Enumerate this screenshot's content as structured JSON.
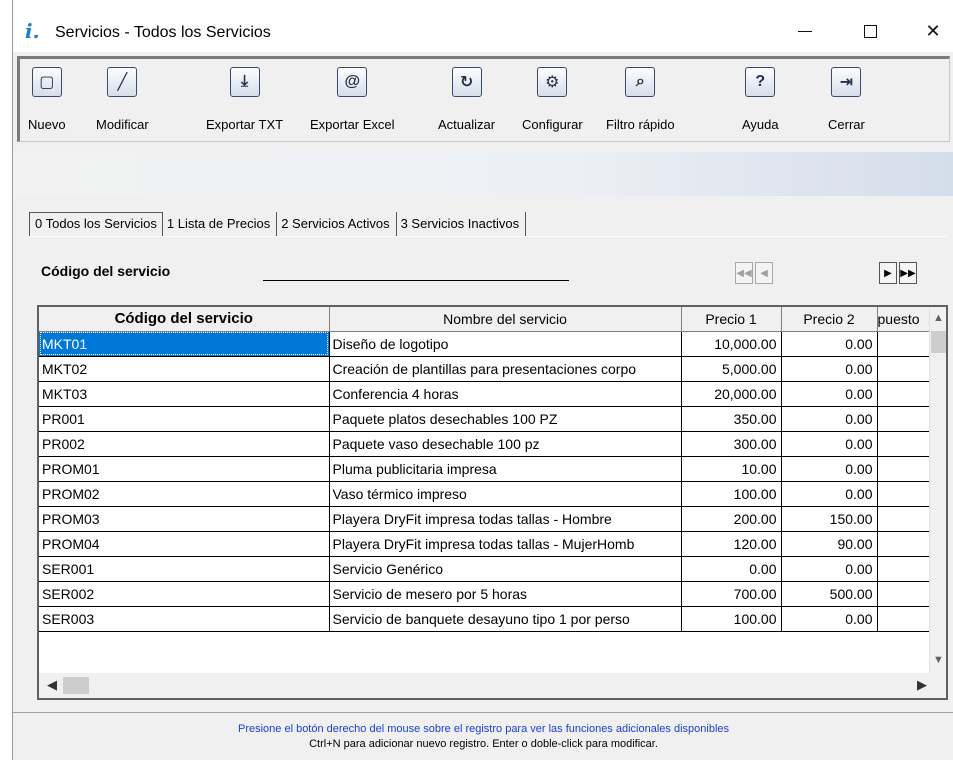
{
  "window": {
    "title": "Servicios - Todos los Servicios",
    "minimize": "—",
    "maximize": "☐",
    "close": "✕"
  },
  "toolbar": {
    "buttons": [
      {
        "label": "Nuevo",
        "icon": "new-document-icon"
      },
      {
        "label": "Modificar",
        "icon": "pencil-icon"
      },
      {
        "label": "Exportar TXT",
        "icon": "export-txt-icon"
      },
      {
        "label": "Exportar Excel",
        "icon": "export-excel-icon"
      },
      {
        "label": "Actualizar",
        "icon": "refresh-icon"
      },
      {
        "label": "Configurar",
        "icon": "gear-icon"
      },
      {
        "label": "Filtro rápido",
        "icon": "search-filter-icon"
      },
      {
        "label": "Ayuda",
        "icon": "help-icon"
      },
      {
        "label": "Cerrar",
        "icon": "exit-icon"
      }
    ]
  },
  "tabs": [
    {
      "label": "0 Todos los Servicios",
      "active": true
    },
    {
      "label": "1 Lista de Precios",
      "active": false
    },
    {
      "label": "2 Servicios Activos",
      "active": false
    },
    {
      "label": "3 Servicios Inactivos",
      "active": false
    }
  ],
  "search": {
    "label": "Código del servicio",
    "value": ""
  },
  "nav": {
    "first": "⏮",
    "prev": "◀",
    "next": "▶",
    "last": "⏭"
  },
  "grid": {
    "columns": [
      "Código del servicio",
      "Nombre del servicio",
      "Precio 1",
      "Precio 2",
      "puesto"
    ],
    "rows": [
      {
        "code": "MKT01",
        "name": "Diseño de logotipo",
        "p1": "10,000.00",
        "p2": "0.00",
        "selected": true
      },
      {
        "code": "MKT02",
        "name": "Creación de plantillas para presentaciones corpo",
        "p1": "5,000.00",
        "p2": "0.00"
      },
      {
        "code": "MKT03",
        "name": "Conferencia 4 horas",
        "p1": "20,000.00",
        "p2": "0.00"
      },
      {
        "code": "PR001",
        "name": "Paquete platos desechables 100 PZ",
        "p1": "350.00",
        "p2": "0.00"
      },
      {
        "code": "PR002",
        "name": "Paquete vaso desechable 100 pz",
        "p1": "300.00",
        "p2": "0.00"
      },
      {
        "code": "PROM01",
        "name": "Pluma publicitaria impresa",
        "p1": "10.00",
        "p2": "0.00"
      },
      {
        "code": "PROM02",
        "name": "Vaso térmico impreso",
        "p1": "100.00",
        "p2": "0.00"
      },
      {
        "code": "PROM03",
        "name": "Playera DryFit  impresa todas tallas - Hombre",
        "p1": "200.00",
        "p2": "150.00"
      },
      {
        "code": "PROM04",
        "name": "Playera DryFit  impresa todas tallas - MujerHomb",
        "p1": "120.00",
        "p2": "90.00"
      },
      {
        "code": "SER001",
        "name": "Servicio Genérico",
        "p1": "0.00",
        "p2": "0.00"
      },
      {
        "code": "SER002",
        "name": "Servicio de mesero por 5 horas",
        "p1": "700.00",
        "p2": "500.00"
      },
      {
        "code": "SER003",
        "name": "Servicio de banquete desayuno tipo 1 por perso",
        "p1": "100.00",
        "p2": "0.00"
      }
    ]
  },
  "status": {
    "line1": "Presione el botón derecho del mouse sobre el registro para ver las funciones adicionales disponibles",
    "line2": "Ctrl+N para adicionar nuevo registro. Enter o doble-click para modificar."
  },
  "colors": {
    "selection": "#0078d7",
    "status_hint": "#1a3fd6"
  }
}
